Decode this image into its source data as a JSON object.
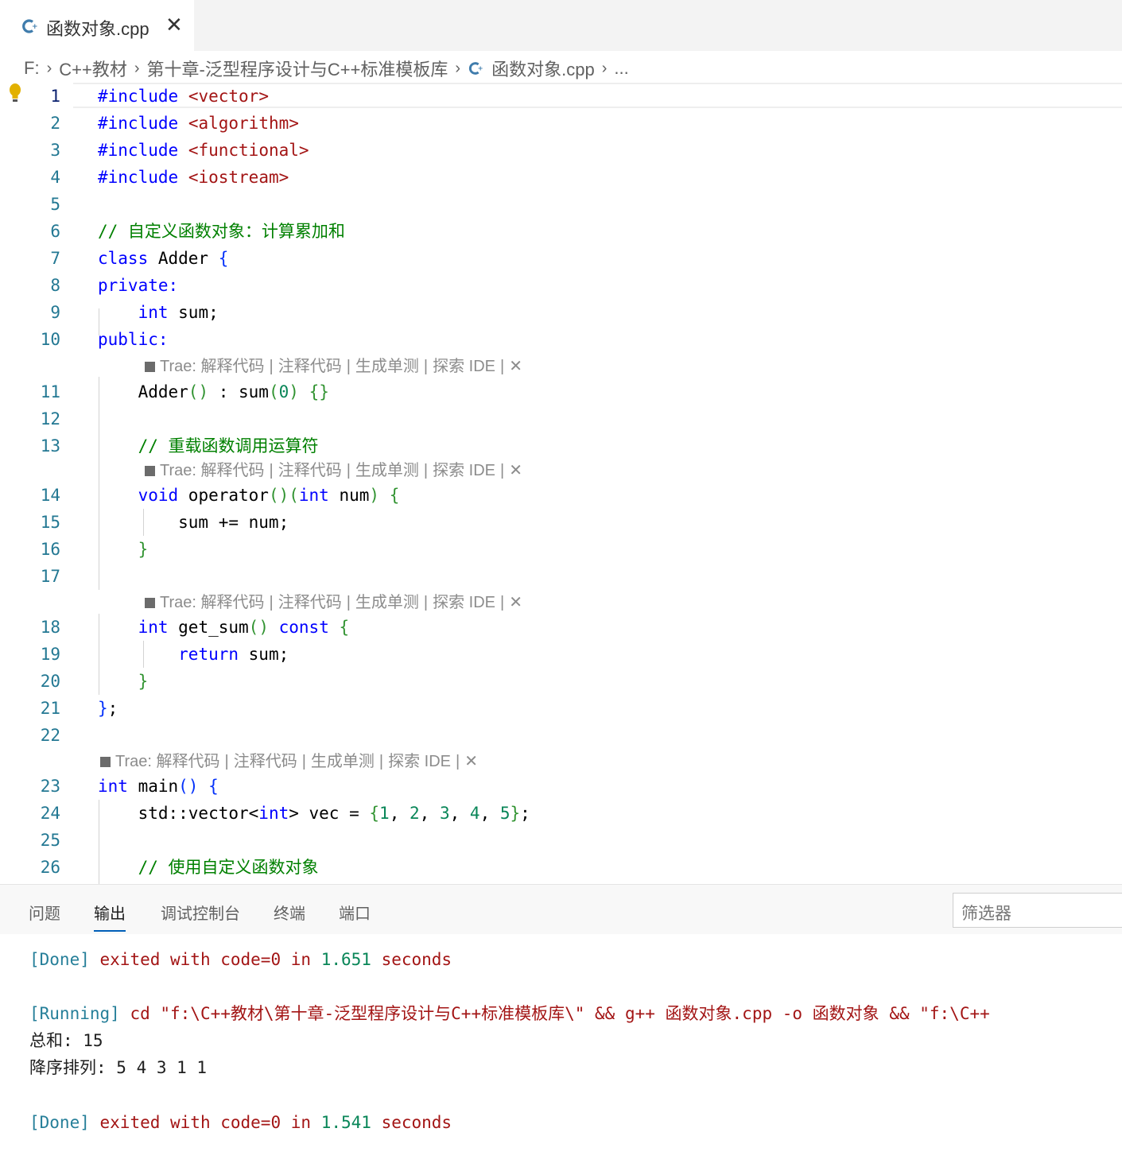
{
  "colors": {
    "accent": "#005fb8",
    "keyword": "#0000ff",
    "string": "#a31515",
    "comment": "#008000",
    "number": "#098658",
    "line_number": "#237893",
    "lightbulb": "#e2b100",
    "cpp_icon": "#3f7cac"
  },
  "tab": {
    "title": "函数对象.cpp",
    "close": "✕",
    "icon": "cpp-file-icon"
  },
  "breadcrumb": {
    "items": [
      "F:",
      "C++教材",
      "第十章-泛型程序设计与C++标准模板库",
      "函数对象.cpp",
      "..."
    ],
    "separator": "›"
  },
  "code_lens": {
    "prefix": "Trae:",
    "actions": [
      "解释代码",
      "注释代码",
      "生成单测",
      "探索 IDE"
    ],
    "close": "✕"
  },
  "editor": {
    "lines": [
      {
        "n": "1",
        "t": "#include <vector>"
      },
      {
        "n": "2",
        "t": "#include <algorithm>"
      },
      {
        "n": "3",
        "t": "#include <functional>"
      },
      {
        "n": "4",
        "t": "#include <iostream>"
      },
      {
        "n": "5",
        "t": ""
      },
      {
        "n": "6",
        "t": "// 自定义函数对象：计算累加和"
      },
      {
        "n": "7",
        "t": "class Adder {"
      },
      {
        "n": "8",
        "t": "private:"
      },
      {
        "n": "9",
        "t": "    int sum;"
      },
      {
        "n": "10",
        "t": "public:"
      },
      {
        "n": "11",
        "t": "    Adder() : sum(0) {}"
      },
      {
        "n": "12",
        "t": ""
      },
      {
        "n": "13",
        "t": "    // 重载函数调用运算符"
      },
      {
        "n": "14",
        "t": "    void operator()(int num) {"
      },
      {
        "n": "15",
        "t": "        sum += num;"
      },
      {
        "n": "16",
        "t": "    }"
      },
      {
        "n": "17",
        "t": ""
      },
      {
        "n": "18",
        "t": "    int get_sum() const {"
      },
      {
        "n": "19",
        "t": "        return sum;"
      },
      {
        "n": "20",
        "t": "    }"
      },
      {
        "n": "21",
        "t": "};"
      },
      {
        "n": "22",
        "t": ""
      },
      {
        "n": "23",
        "t": "int main() {"
      },
      {
        "n": "24",
        "t": "    std::vector<int> vec = {1, 2, 3, 4, 5};"
      },
      {
        "n": "25",
        "t": ""
      },
      {
        "n": "26",
        "t": "    // 使用自定义函数对象"
      }
    ]
  },
  "panel": {
    "tabs": [
      "问题",
      "输出",
      "调试控制台",
      "终端",
      "端口"
    ],
    "active_tab": "输出",
    "filter_placeholder": "筛选器",
    "output": {
      "done1": {
        "tag": "[Done]",
        "text": "exited with code=0 in",
        "num": "1.651",
        "unit": "seconds"
      },
      "running": {
        "tag": "[Running]",
        "text": "cd \"f:\\C++教材\\第十章-泛型程序设计与C++标准模板库\\\" && g++ 函数对象.cpp -o 函数对象 && \"f:\\C++"
      },
      "line_sum": "总和: 15",
      "line_sort": "降序排列: 5 4 3 1 1",
      "done2": {
        "tag": "[Done]",
        "text": "exited with code=0 in",
        "num": "1.541",
        "unit": "seconds"
      }
    }
  }
}
